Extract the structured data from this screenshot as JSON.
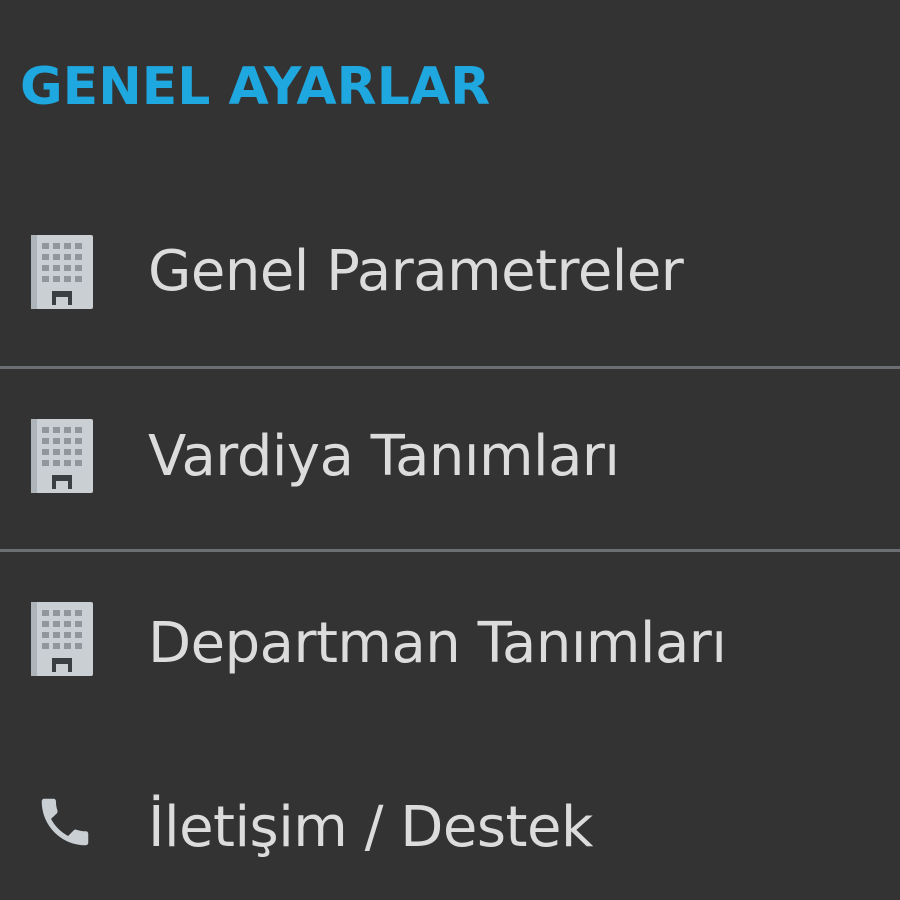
{
  "sidebar": {
    "section_title": "GENEL AYARLAR",
    "accent_color": "#1fa8e0",
    "items": [
      {
        "label": "Genel Parametreler",
        "icon": "building-icon"
      },
      {
        "label": "Vardiya Tanımları",
        "icon": "building-icon"
      },
      {
        "label": "Departman Tanımları",
        "icon": "building-icon"
      },
      {
        "label": "İletişim / Destek",
        "icon": "phone-icon"
      }
    ]
  }
}
